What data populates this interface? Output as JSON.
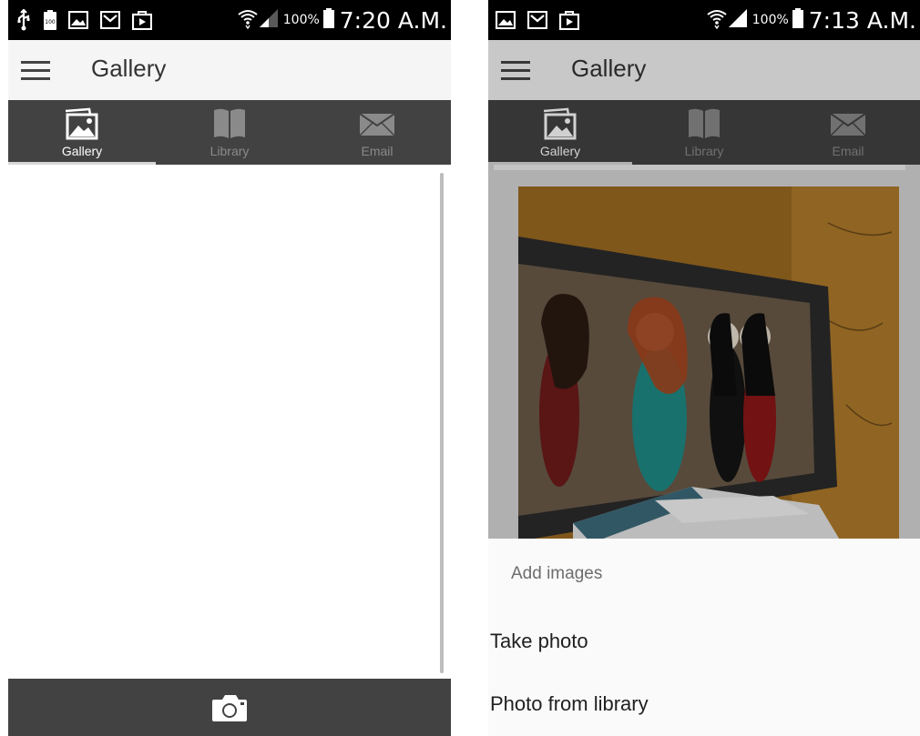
{
  "left_screen": {
    "status_bar": {
      "icons": [
        "usb-icon",
        "battery-100-icon",
        "image-icon",
        "gmail-icon",
        "briefcase-icon",
        "wifi-icon",
        "signal-icon",
        "battery-icon"
      ],
      "battery_percent": "100%",
      "time": "7:20 A.M."
    },
    "action_bar": {
      "menu_icon": "hamburger-menu-icon",
      "title": "Gallery"
    },
    "tabs": [
      {
        "label": "Gallery",
        "icon": "gallery-icon",
        "active": true
      },
      {
        "label": "Library",
        "icon": "book-icon",
        "active": false
      },
      {
        "label": "Email",
        "icon": "envelope-icon",
        "active": false
      }
    ],
    "bottom_bar": {
      "icon": "camera-icon"
    }
  },
  "right_screen": {
    "status_bar": {
      "icons": [
        "image-icon",
        "gmail-icon",
        "briefcase-icon",
        "wifi-icon",
        "signal-icon",
        "battery-icon"
      ],
      "battery_percent": "100%",
      "time": "7:13 A.M."
    },
    "action_bar": {
      "menu_icon": "hamburger-menu-icon",
      "title": "Gallery"
    },
    "tabs": [
      {
        "label": "Gallery",
        "icon": "gallery-icon",
        "active": true
      },
      {
        "label": "Library",
        "icon": "book-icon",
        "active": false
      },
      {
        "label": "Email",
        "icon": "envelope-icon",
        "active": false
      }
    ],
    "sheet": {
      "title": "Add images",
      "items": [
        {
          "label": "Take photo"
        },
        {
          "label": "Photo from library"
        }
      ]
    }
  },
  "colors": {
    "status_bar": "#000000",
    "action_bar": "#f5f5f5",
    "tab_bar": "#424242",
    "tab_active_text": "#ffffff",
    "tab_inactive_text": "#8a8a8a",
    "sheet_background": "#fafafa"
  }
}
